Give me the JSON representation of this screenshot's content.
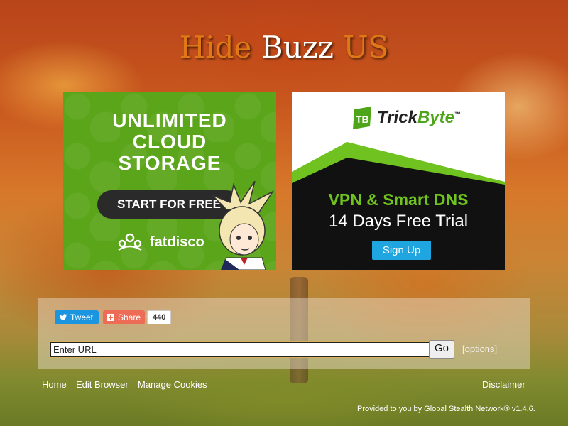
{
  "title": {
    "w1": "Hide",
    "w2": "Buzz",
    "w3": "US"
  },
  "ads": {
    "left": {
      "headline": [
        "UNLIMITED",
        "CLOUD",
        "STORAGE"
      ],
      "cta": "START FOR FREE",
      "brand": "fatdisco",
      "bg_color": "#5aa51a"
    },
    "right": {
      "logo_prefix": "Trick",
      "logo_suffix": "Byte",
      "tm": "™",
      "line1": "VPN & Smart DNS",
      "line2": "14 Days Free Trial",
      "cta": "Sign Up",
      "accent_color": "#6fc21f"
    }
  },
  "social": {
    "tweet": "Tweet",
    "share": "Share",
    "share_count": "440"
  },
  "form": {
    "url_value": "Enter URL",
    "go": "Go",
    "options": "[options]"
  },
  "footer": {
    "home": "Home",
    "edit_browser": "Edit Browser",
    "manage_cookies": "Manage Cookies",
    "disclaimer": "Disclaimer",
    "credit": "Provided to you by Global Stealth Network® v1.4.6."
  }
}
